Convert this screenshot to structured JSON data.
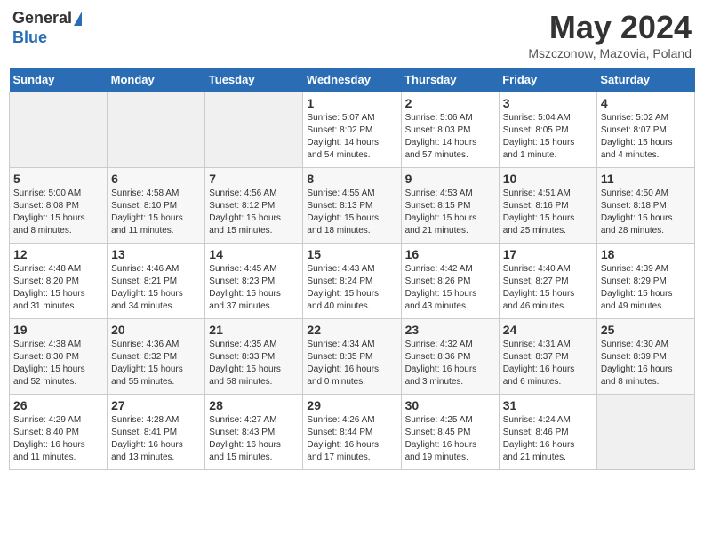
{
  "header": {
    "logo_line1": "General",
    "logo_line2": "Blue",
    "title": "May 2024",
    "location": "Mszczonow, Mazovia, Poland"
  },
  "days_of_week": [
    "Sunday",
    "Monday",
    "Tuesday",
    "Wednesday",
    "Thursday",
    "Friday",
    "Saturday"
  ],
  "weeks": [
    [
      {
        "day": "",
        "info": ""
      },
      {
        "day": "",
        "info": ""
      },
      {
        "day": "",
        "info": ""
      },
      {
        "day": "1",
        "info": "Sunrise: 5:07 AM\nSunset: 8:02 PM\nDaylight: 14 hours\nand 54 minutes."
      },
      {
        "day": "2",
        "info": "Sunrise: 5:06 AM\nSunset: 8:03 PM\nDaylight: 14 hours\nand 57 minutes."
      },
      {
        "day": "3",
        "info": "Sunrise: 5:04 AM\nSunset: 8:05 PM\nDaylight: 15 hours\nand 1 minute."
      },
      {
        "day": "4",
        "info": "Sunrise: 5:02 AM\nSunset: 8:07 PM\nDaylight: 15 hours\nand 4 minutes."
      }
    ],
    [
      {
        "day": "5",
        "info": "Sunrise: 5:00 AM\nSunset: 8:08 PM\nDaylight: 15 hours\nand 8 minutes."
      },
      {
        "day": "6",
        "info": "Sunrise: 4:58 AM\nSunset: 8:10 PM\nDaylight: 15 hours\nand 11 minutes."
      },
      {
        "day": "7",
        "info": "Sunrise: 4:56 AM\nSunset: 8:12 PM\nDaylight: 15 hours\nand 15 minutes."
      },
      {
        "day": "8",
        "info": "Sunrise: 4:55 AM\nSunset: 8:13 PM\nDaylight: 15 hours\nand 18 minutes."
      },
      {
        "day": "9",
        "info": "Sunrise: 4:53 AM\nSunset: 8:15 PM\nDaylight: 15 hours\nand 21 minutes."
      },
      {
        "day": "10",
        "info": "Sunrise: 4:51 AM\nSunset: 8:16 PM\nDaylight: 15 hours\nand 25 minutes."
      },
      {
        "day": "11",
        "info": "Sunrise: 4:50 AM\nSunset: 8:18 PM\nDaylight: 15 hours\nand 28 minutes."
      }
    ],
    [
      {
        "day": "12",
        "info": "Sunrise: 4:48 AM\nSunset: 8:20 PM\nDaylight: 15 hours\nand 31 minutes."
      },
      {
        "day": "13",
        "info": "Sunrise: 4:46 AM\nSunset: 8:21 PM\nDaylight: 15 hours\nand 34 minutes."
      },
      {
        "day": "14",
        "info": "Sunrise: 4:45 AM\nSunset: 8:23 PM\nDaylight: 15 hours\nand 37 minutes."
      },
      {
        "day": "15",
        "info": "Sunrise: 4:43 AM\nSunset: 8:24 PM\nDaylight: 15 hours\nand 40 minutes."
      },
      {
        "day": "16",
        "info": "Sunrise: 4:42 AM\nSunset: 8:26 PM\nDaylight: 15 hours\nand 43 minutes."
      },
      {
        "day": "17",
        "info": "Sunrise: 4:40 AM\nSunset: 8:27 PM\nDaylight: 15 hours\nand 46 minutes."
      },
      {
        "day": "18",
        "info": "Sunrise: 4:39 AM\nSunset: 8:29 PM\nDaylight: 15 hours\nand 49 minutes."
      }
    ],
    [
      {
        "day": "19",
        "info": "Sunrise: 4:38 AM\nSunset: 8:30 PM\nDaylight: 15 hours\nand 52 minutes."
      },
      {
        "day": "20",
        "info": "Sunrise: 4:36 AM\nSunset: 8:32 PM\nDaylight: 15 hours\nand 55 minutes."
      },
      {
        "day": "21",
        "info": "Sunrise: 4:35 AM\nSunset: 8:33 PM\nDaylight: 15 hours\nand 58 minutes."
      },
      {
        "day": "22",
        "info": "Sunrise: 4:34 AM\nSunset: 8:35 PM\nDaylight: 16 hours\nand 0 minutes."
      },
      {
        "day": "23",
        "info": "Sunrise: 4:32 AM\nSunset: 8:36 PM\nDaylight: 16 hours\nand 3 minutes."
      },
      {
        "day": "24",
        "info": "Sunrise: 4:31 AM\nSunset: 8:37 PM\nDaylight: 16 hours\nand 6 minutes."
      },
      {
        "day": "25",
        "info": "Sunrise: 4:30 AM\nSunset: 8:39 PM\nDaylight: 16 hours\nand 8 minutes."
      }
    ],
    [
      {
        "day": "26",
        "info": "Sunrise: 4:29 AM\nSunset: 8:40 PM\nDaylight: 16 hours\nand 11 minutes."
      },
      {
        "day": "27",
        "info": "Sunrise: 4:28 AM\nSunset: 8:41 PM\nDaylight: 16 hours\nand 13 minutes."
      },
      {
        "day": "28",
        "info": "Sunrise: 4:27 AM\nSunset: 8:43 PM\nDaylight: 16 hours\nand 15 minutes."
      },
      {
        "day": "29",
        "info": "Sunrise: 4:26 AM\nSunset: 8:44 PM\nDaylight: 16 hours\nand 17 minutes."
      },
      {
        "day": "30",
        "info": "Sunrise: 4:25 AM\nSunset: 8:45 PM\nDaylight: 16 hours\nand 19 minutes."
      },
      {
        "day": "31",
        "info": "Sunrise: 4:24 AM\nSunset: 8:46 PM\nDaylight: 16 hours\nand 21 minutes."
      },
      {
        "day": "",
        "info": ""
      }
    ]
  ]
}
